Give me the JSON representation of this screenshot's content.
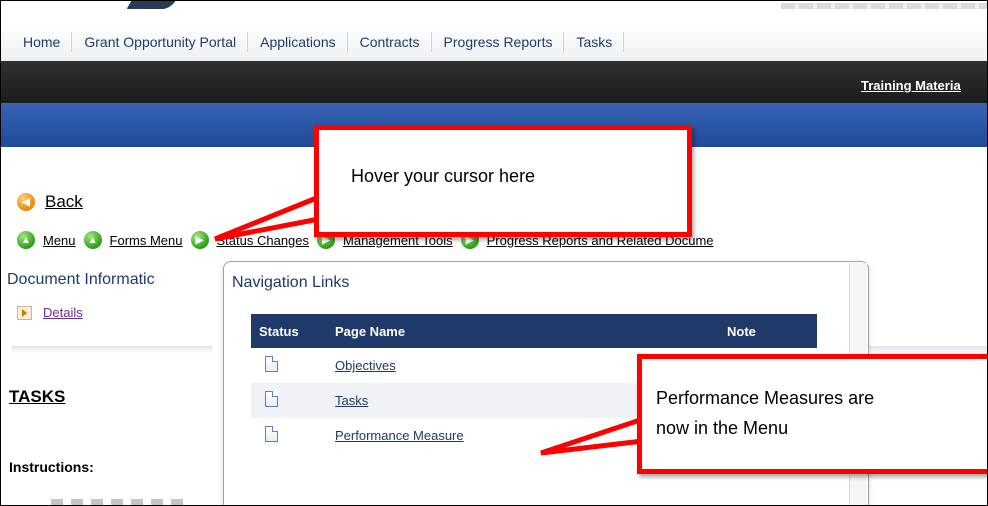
{
  "nav_tabs": [
    "Home",
    "Grant Opportunity Portal",
    "Applications",
    "Contracts",
    "Progress Reports",
    "Tasks"
  ],
  "header": {
    "training_link": "Training Materia"
  },
  "back_link": "Back",
  "menu_links": [
    "Menu",
    "Forms Menu",
    "Status Changes",
    "Management Tools",
    "Progress Reports and Related Docume"
  ],
  "left_panel": {
    "doc_info_title": "Document Informatic",
    "details_link": "Details",
    "tasks_heading": "TASKS",
    "instructions_label": "Instructions:"
  },
  "popup": {
    "title": "Navigation Links",
    "columns": [
      "Status",
      "Page Name",
      "Note"
    ],
    "rows": [
      {
        "page_name": "Objectives"
      },
      {
        "page_name": "Tasks"
      },
      {
        "page_name": "Performance Measure"
      }
    ]
  },
  "annotations": {
    "callout_1": "Hover your cursor here",
    "callout_2_line1": "Performance Measures are",
    "callout_2_line2": "now in the Menu",
    "color": "#ff0000"
  },
  "colors": {
    "dark_bar": "#262626",
    "blue_bar": "#2a57a8",
    "table_header": "#1f3a68"
  }
}
